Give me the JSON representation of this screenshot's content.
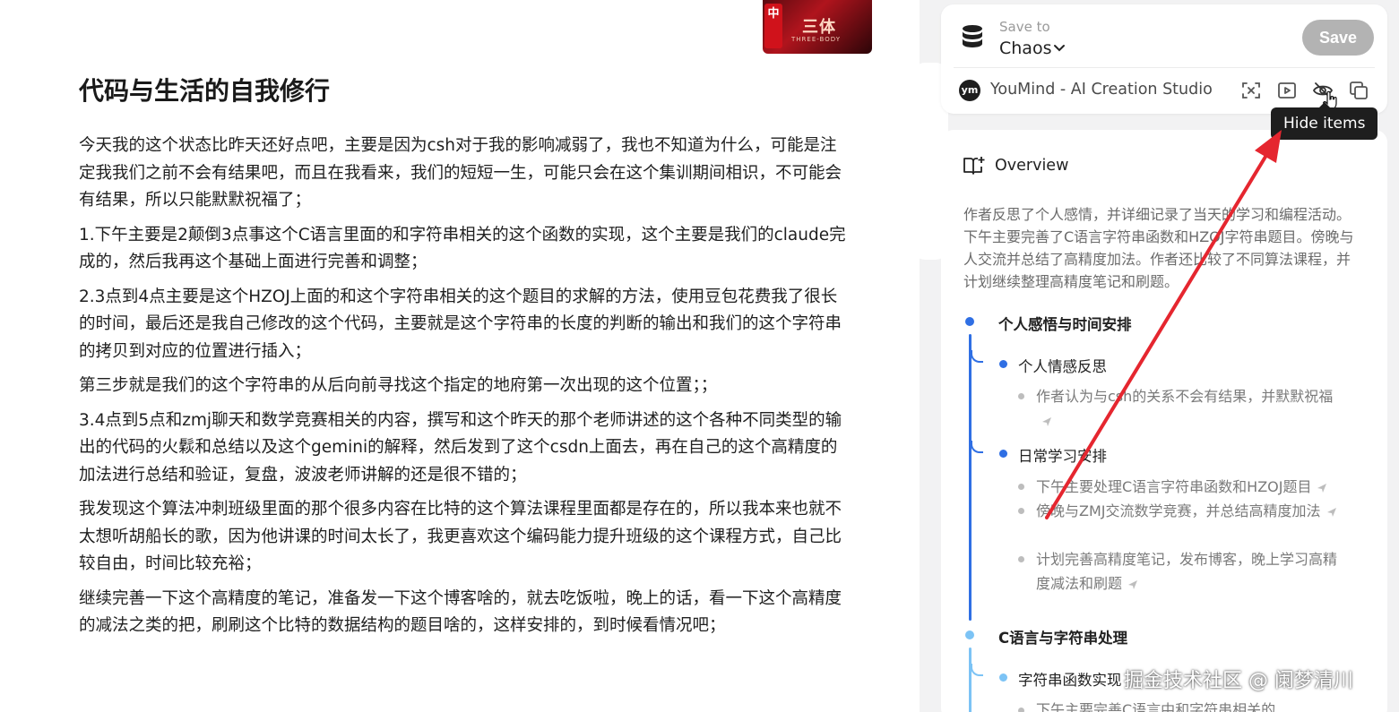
{
  "article": {
    "thumbnail": {
      "badge": "中",
      "title": "三体",
      "subtitle": "THREE-BODY"
    },
    "title": "代码与生活的自我修行",
    "paragraphs": [
      "今天我的这个状态比昨天还好点吧，主要是因为csh对于我的影响减弱了，我也不知道为什么，可能是注定我我们之前不会有结果吧，而且在我看来，我们的短短一生，可能只会在这个集训期间相识，不可能会有结果，所以只能默默祝福了；",
      "1.下午主要是2颠倒3点事这个C语言里面的和字符串相关的这个函数的实现，这个主要是我们的claude完成的，然后我再这个基础上面进行完善和调整；",
      "2.3点到4点主要是这个HZOJ上面的和这个字符串相关的这个题目的求解的方法，使用豆包花费我了很长的时间，最后还是我自己修改的这个代码，主要就是这个字符串的长度的判断的输出和我们的这个字符串的拷贝到对应的位置进行插入；",
      "第三步就是我们的这个字符串的从后向前寻找这个指定的地府第一次出现的这个位置；；",
      "3.4点到5点和zmj聊天和数学竞赛相关的内容，撰写和这个昨天的那个老师讲述的这个各种不同类型的输出的代码的火鬏和总结以及这个gemini的解释，然后发到了这个csdn上面去，再在自己的这个高精度的加法进行总结和验证，复盘，波波老师讲解的还是很不错的；",
      "我发现这个算法冲刺班级里面的那个很多内容在比特的这个算法课程里面都是存在的，所以我本来也就不太想听胡船长的歌，因为他讲课的时间太长了，我更喜欢这个编码能力提升班级的这个课程方式，自己比较自由，时间比较充裕；",
      "继续完善一下这个高精度的笔记，准备发一下这个博客啥的，就去吃饭啦，晚上的话，看一下这个高精度的减法之类的把，刷刷这个比特的数据结构的题目啥的，这样安排的，到时候看情况吧；"
    ]
  },
  "save_panel": {
    "save_to_label": "Save to",
    "space_name": "Chaos",
    "save_button": "Save",
    "source_name": "YouMind - AI Creation Studio",
    "logo_text": "ym",
    "toolbar_icons": [
      "screenshot-icon",
      "video-icon",
      "hide-eye-icon",
      "copy-icon"
    ],
    "tooltip": "Hide items"
  },
  "overview": {
    "title": "Overview",
    "summary": "作者反思了个人感情，并详细记录了当天的学习和编程活动。下午主要完善了C语言字符串函数和HZOJ字符串题目。傍晚与人交流并总结了高精度加法。作者还比较了不同算法课程，并计划继续整理高精度笔记和刷题。",
    "sections": [
      {
        "title": "个人感悟与时间安排",
        "subsections": [
          {
            "title": "个人情感反思",
            "items": [
              "作者认为与csh的关系不会有结果，并默默祝福"
            ]
          },
          {
            "title": "日常学习安排",
            "items": [
              "下午主要处理C语言字符串函数和HZOJ题目",
              "傍晚与ZMJ交流数学竞赛，并总结高精度加法",
              "计划完善高精度笔记，发布博客，晚上学习高精度减法和刷题"
            ]
          }
        ]
      },
      {
        "title": "C语言与字符串处理",
        "subsections": [
          {
            "title": "字符串函数实现",
            "items": [
              "下午主要完善C语言中和字符串相关的"
            ]
          }
        ]
      }
    ]
  },
  "watermark": "掘金技术社区 @ 阑梦清川",
  "colors": {
    "accent_blue": "#2f6fe4",
    "light_blue": "#7cc3f5",
    "arrow_red": "#e5262f",
    "save_disabled": "#b3b3b3"
  }
}
